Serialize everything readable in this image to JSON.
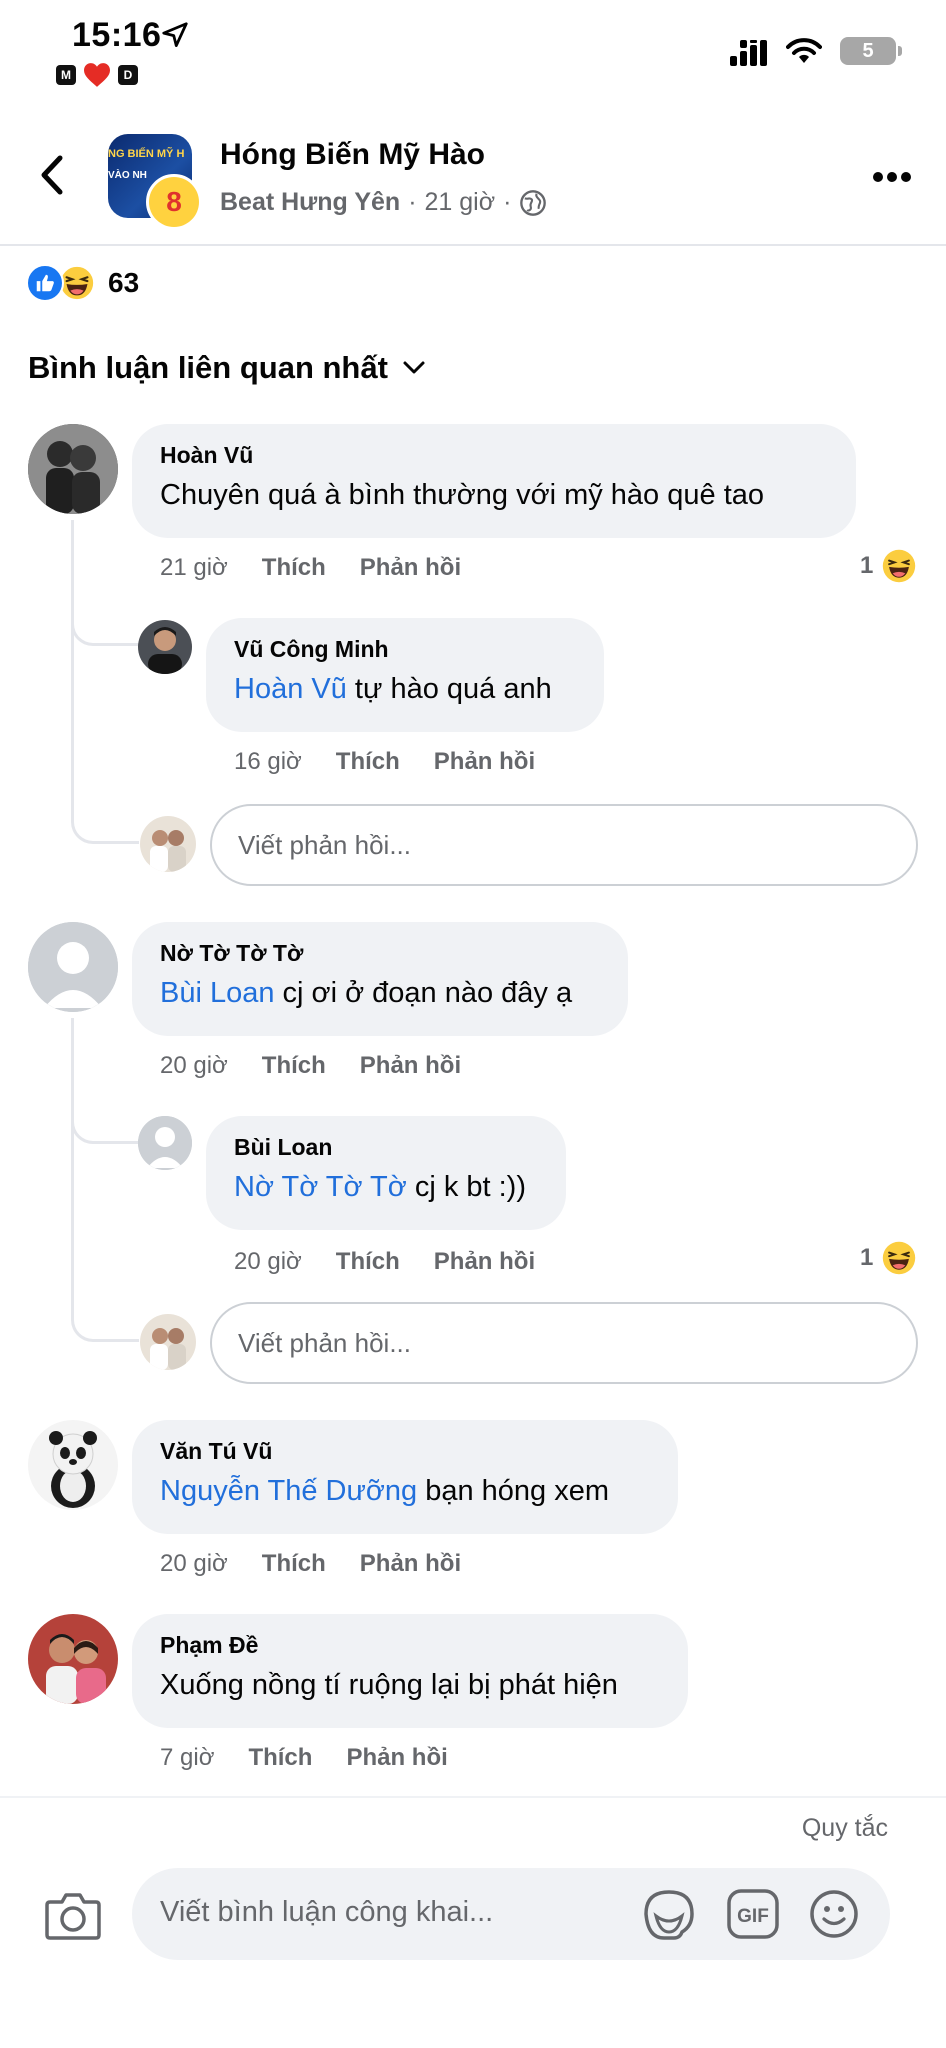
{
  "status": {
    "time": "15:16",
    "badge_left": "M",
    "badge_right": "D",
    "battery": "5"
  },
  "post": {
    "page_name": "Hóng Biến Mỹ Hào",
    "source": "Beat Hưng Yên",
    "time": "21 giờ",
    "separator": "·",
    "reaction_count": "63",
    "avatar_text_1": "NG BIẾN MỸ H",
    "avatar_text_2": "VÀO NH",
    "badge_text": "8"
  },
  "sort_label": "Bình luận liên quan nhất",
  "comments": [
    {
      "author": "Hoàn Vũ",
      "text": "Chuyên quá à bình thường  với mỹ hào quê tao",
      "time": "21 giờ",
      "like": "Thích",
      "reply": "Phản hồi",
      "reaction_count": "1",
      "replies": [
        {
          "author": "Vũ Công Minh",
          "mention": "Hoàn Vũ",
          "text": " tự hào quá anh",
          "time": "16 giờ",
          "like": "Thích",
          "reply": "Phản hồi"
        }
      ],
      "reply_placeholder": "Viết phản hồi..."
    },
    {
      "author": "Nờ Tờ Tờ Tờ",
      "mention": "Bùi Loan",
      "text": " cj ơi ở đoạn nào đây ạ",
      "time": "20 giờ",
      "like": "Thích",
      "reply": "Phản hồi",
      "replies": [
        {
          "author": "Bùi Loan",
          "mention": "Nờ Tờ Tờ Tờ",
          "text": " cj k bt :))",
          "time": "20 giờ",
          "like": "Thích",
          "reply": "Phản hồi",
          "reaction_count": "1"
        }
      ],
      "reply_placeholder": "Viết phản hồi..."
    },
    {
      "author": "Văn Tú Vũ",
      "mention": "Nguyễn Thế Dưỡng",
      "text": "  bạn hóng xem",
      "time": "20 giờ",
      "like": "Thích",
      "reply": "Phản hồi"
    },
    {
      "author": "Phạm Đề",
      "text": "Xuống nồng tí ruộng lại bị phát hiện",
      "time": "7 giờ",
      "like": "Thích",
      "reply": "Phản hồi"
    }
  ],
  "footer": {
    "rules": "Quy tắc",
    "placeholder": "Viết bình luận công khai...",
    "gif_label": "GIF"
  },
  "colors": {
    "mention": "#216fdb",
    "like_blue": "#1877f2",
    "bubble_bg": "#f0f2f5",
    "secondary_text": "#65676b"
  }
}
